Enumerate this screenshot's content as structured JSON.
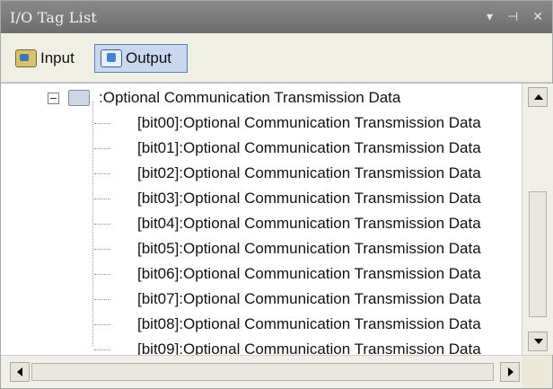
{
  "panel": {
    "title": "I/O Tag List",
    "title_icons": [
      "dropdown-icon",
      "pin-icon",
      "close-icon"
    ]
  },
  "toolbar": {
    "input_label": "Input",
    "output_label": "Output",
    "active": "Output"
  },
  "tree": {
    "root_label": ":Optional Communication Transmission Data",
    "items": [
      {
        "label": "[bit00]:Optional Communication Transmission Data"
      },
      {
        "label": "[bit01]:Optional Communication Transmission Data"
      },
      {
        "label": "[bit02]:Optional Communication Transmission Data"
      },
      {
        "label": "[bit03]:Optional Communication Transmission Data"
      },
      {
        "label": "[bit04]:Optional Communication Transmission Data"
      },
      {
        "label": "[bit05]:Optional Communication Transmission Data"
      },
      {
        "label": "[bit06]:Optional Communication Transmission Data"
      },
      {
        "label": "[bit07]:Optional Communication Transmission Data"
      },
      {
        "label": "[bit08]:Optional Communication Transmission Data"
      },
      {
        "label": "[bit09]:Optional Communication Transmission Data"
      }
    ]
  }
}
